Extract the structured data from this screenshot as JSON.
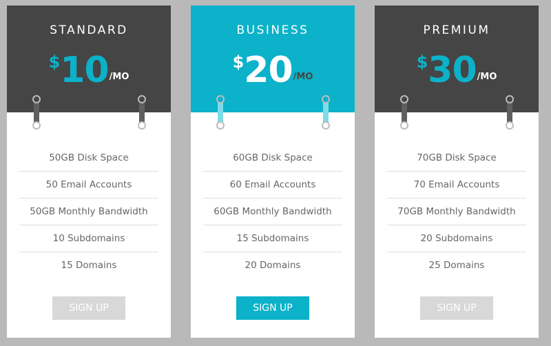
{
  "colors": {
    "page_background": "#b9b9b9",
    "dark_header": "#454545",
    "accent": "#0bb2c9",
    "accent_light": "#7fdbe8",
    "feature_text": "#666666",
    "button_inactive": "#d8d8d8"
  },
  "plans": [
    {
      "name": "STANDARD",
      "currency": "$",
      "amount": "10",
      "period": "/MO",
      "features": [
        "50GB Disk Space",
        "50 Email Accounts",
        "50GB Monthly Bandwidth",
        "10 Subdomains",
        "15 Domains"
      ],
      "button_label": "SIGN UP"
    },
    {
      "name": "BUSINESS",
      "currency": "$",
      "amount": "20",
      "period": "/MO",
      "features": [
        "60GB Disk Space",
        "60 Email Accounts",
        "60GB Monthly Bandwidth",
        "15 Subdomains",
        "20 Domains"
      ],
      "button_label": "SIGN UP"
    },
    {
      "name": "PREMIUM",
      "currency": "$",
      "amount": "30",
      "period": "/MO",
      "features": [
        "70GB Disk Space",
        "70 Email Accounts",
        "70GB Monthly Bandwidth",
        "20 Subdomains",
        "25 Domains"
      ],
      "button_label": "SIGN UP"
    }
  ]
}
